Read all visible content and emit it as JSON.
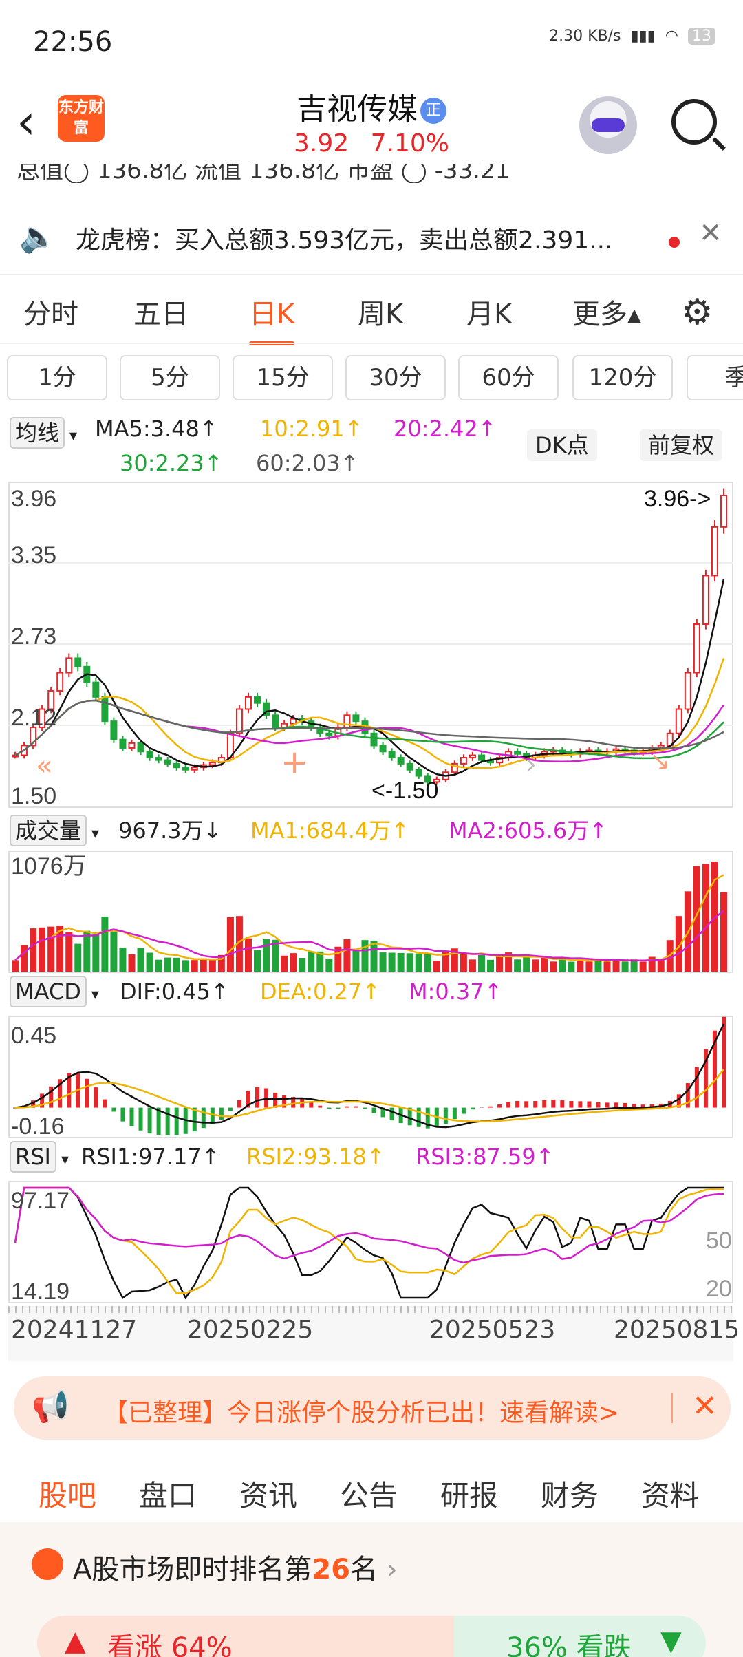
{
  "status_bar": {
    "time": "22:56",
    "net_speed": "2.30 KB/s",
    "battery": "13"
  },
  "header": {
    "stock_name": "吉视传媒",
    "badge": "正",
    "price": "3.92",
    "change_pct": "7.10%",
    "logo_text": "东方财富"
  },
  "metrics_strip": "总值◯ 136.8亿  流值 136.8亿  市盈 ◯ -33.21",
  "notice": {
    "text": "龙虎榜：买入总额3.593亿元，卖出总额2.391..."
  },
  "period_tabs": [
    {
      "label": "分时"
    },
    {
      "label": "五日"
    },
    {
      "label": "日K"
    },
    {
      "label": "周K"
    },
    {
      "label": "月K"
    },
    {
      "label": "更多▴"
    }
  ],
  "minute_tabs": [
    {
      "label": "1分"
    },
    {
      "label": "5分"
    },
    {
      "label": "15分"
    },
    {
      "label": "30分"
    },
    {
      "label": "60分"
    },
    {
      "label": "120分"
    },
    {
      "label": "季"
    }
  ],
  "ma_legend": {
    "selector": "均线",
    "ma5": "MA5:3.48↑",
    "ma10": "10:2.91↑",
    "ma20": "20:2.42↑",
    "ma30": "30:2.23↑",
    "ma60": "60:2.03↑",
    "dk": "DK点",
    "adjust": "前复权"
  },
  "colors": {
    "up": "#e8262a",
    "down": "#1fa53a",
    "ma5": "#111111",
    "ma10": "#f0b400",
    "ma20": "#d21ecc",
    "ma30": "#1fa53a",
    "ma60": "#666666",
    "accent": "#ff5a1f"
  },
  "chart_data": [
    {
      "type": "line",
      "title": "日K",
      "ylabels": [
        "3.96",
        "3.35",
        "2.73",
        "2.12",
        "1.50"
      ],
      "ylim": [
        1.5,
        3.96
      ],
      "high_label": "3.96->",
      "low_label": "<-1.50",
      "x_dates": [
        "20241127",
        "20250225",
        "20250523",
        "20250815"
      ],
      "close": [
        1.82,
        1.9,
        2.05,
        2.2,
        2.35,
        2.5,
        2.62,
        2.55,
        2.42,
        2.3,
        2.1,
        1.95,
        1.88,
        1.92,
        1.85,
        1.8,
        1.78,
        1.75,
        1.72,
        1.7,
        1.72,
        1.74,
        1.76,
        1.8,
        2.0,
        2.2,
        2.3,
        2.25,
        2.15,
        2.05,
        2.08,
        2.12,
        2.1,
        2.05,
        2.0,
        1.98,
        2.05,
        2.15,
        2.1,
        2.0,
        1.9,
        1.85,
        1.8,
        1.75,
        1.7,
        1.65,
        1.6,
        1.62,
        1.68,
        1.75,
        1.8,
        1.82,
        1.78,
        1.76,
        1.8,
        1.85,
        1.83,
        1.8,
        1.82,
        1.85,
        1.86,
        1.84,
        1.83,
        1.85,
        1.86,
        1.84,
        1.85,
        1.87,
        1.86,
        1.84,
        1.85,
        1.88,
        1.9,
        2.0,
        2.2,
        2.5,
        2.9,
        3.3,
        3.7,
        3.96
      ]
    },
    {
      "type": "bar",
      "title": "成交量",
      "value_label": "967.3万↓",
      "ma1": "MA1:684.4万↑",
      "ma2": "MA2:605.6万↑",
      "ymax_label": "1076万"
    },
    {
      "type": "bar",
      "title": "MACD",
      "dif": "DIF:0.45↑",
      "dea": "DEA:0.27↑",
      "m": "M:0.37↑",
      "ylabels": [
        "0.45",
        "-0.16"
      ]
    },
    {
      "type": "line",
      "title": "RSI",
      "rsi1": "RSI1:97.17↑",
      "rsi2": "RSI2:93.18↑",
      "rsi3": "RSI3:87.59↑",
      "ylabels": [
        "97.17",
        "14.19"
      ],
      "right_labels": [
        "50",
        "20"
      ]
    }
  ],
  "ad": {
    "text": "【已整理】今日涨停个股分析已出！速看解读>"
  },
  "bottom_tabs": [
    {
      "label": "股吧"
    },
    {
      "label": "盘口"
    },
    {
      "label": "资讯"
    },
    {
      "label": "公告"
    },
    {
      "label": "研报"
    },
    {
      "label": "财务"
    },
    {
      "label": "资料"
    }
  ],
  "rank": {
    "prefix": "A股市场即时排名第",
    "number": "26",
    "suffix": "名",
    "bull": "看涨 64%",
    "bear": "36% 看跌"
  }
}
